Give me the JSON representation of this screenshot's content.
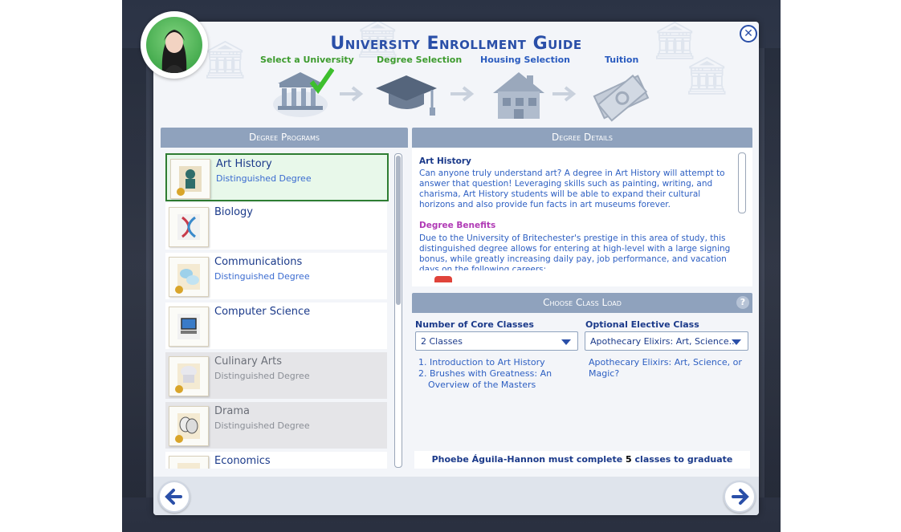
{
  "dialog": {
    "title": "University Enrollment Guide",
    "close_label": "✕"
  },
  "steps": [
    {
      "label": "Select a University",
      "color": "#3d9b2e"
    },
    {
      "label": "Degree Selection",
      "color": "#3d9b2e"
    },
    {
      "label": "Housing Selection",
      "color": "#2a5bbf"
    },
    {
      "label": "Tuition",
      "color": "#2a5bbf"
    }
  ],
  "programs": {
    "header": "Degree Programs",
    "items": [
      {
        "name": "Art History",
        "sub": "Distinguished Degree",
        "state": "selected",
        "icon": "sculpture-icon"
      },
      {
        "name": "Biology",
        "sub": "",
        "state": "normal",
        "icon": "dna-icon"
      },
      {
        "name": "Communications",
        "sub": "Distinguished Degree",
        "state": "normal",
        "icon": "speech-bubbles-icon"
      },
      {
        "name": "Computer Science",
        "sub": "",
        "state": "normal",
        "icon": "computer-icon"
      },
      {
        "name": "Culinary Arts",
        "sub": "Distinguished Degree",
        "state": "disabled",
        "icon": "chef-hat-icon"
      },
      {
        "name": "Drama",
        "sub": "Distinguished Degree",
        "state": "disabled",
        "icon": "drama-masks-icon"
      },
      {
        "name": "Economics",
        "sub": "",
        "state": "normal",
        "icon": "economics-icon"
      }
    ]
  },
  "details": {
    "header": "Degree Details",
    "title": "Art History",
    "description": "Can anyone truly understand art? A degree in Art History will attempt to answer that question! Leveraging skills such as painting, writing, and charisma, Art History students will be able to expand their cultural horizons and also provide fun facts in art museums forever.",
    "benefits_title": "Degree Benefits",
    "benefits_text": "Due to the University of Britechester's prestige in this area of study, this distinguished degree allows for entering at high-level with a large signing bonus, while greatly increasing daily pay, job performance, and vacation days on the following careers:"
  },
  "class_load": {
    "header": "Choose Class Load",
    "help_label": "?",
    "core_label": "Number of Core Classes",
    "core_value": "2 Classes",
    "core_classes": [
      "1. Introduction to Art History",
      "2. Brushes with Greatness: An",
      "Overview of the Masters"
    ],
    "elective_label": "Optional Elective Class",
    "elective_value": "Apothecary Elixirs: Art, Science...",
    "elective_desc_1": "Apothecary Elixirs: Art, Science, or",
    "elective_desc_2": "Magic?",
    "footer_prefix": "Phoebe Águila-Hannon must complete ",
    "footer_count": "5",
    "footer_suffix": " classes to graduate"
  },
  "nav": {
    "back_icon": "arrow-left-icon",
    "next_icon": "arrow-right-icon"
  }
}
